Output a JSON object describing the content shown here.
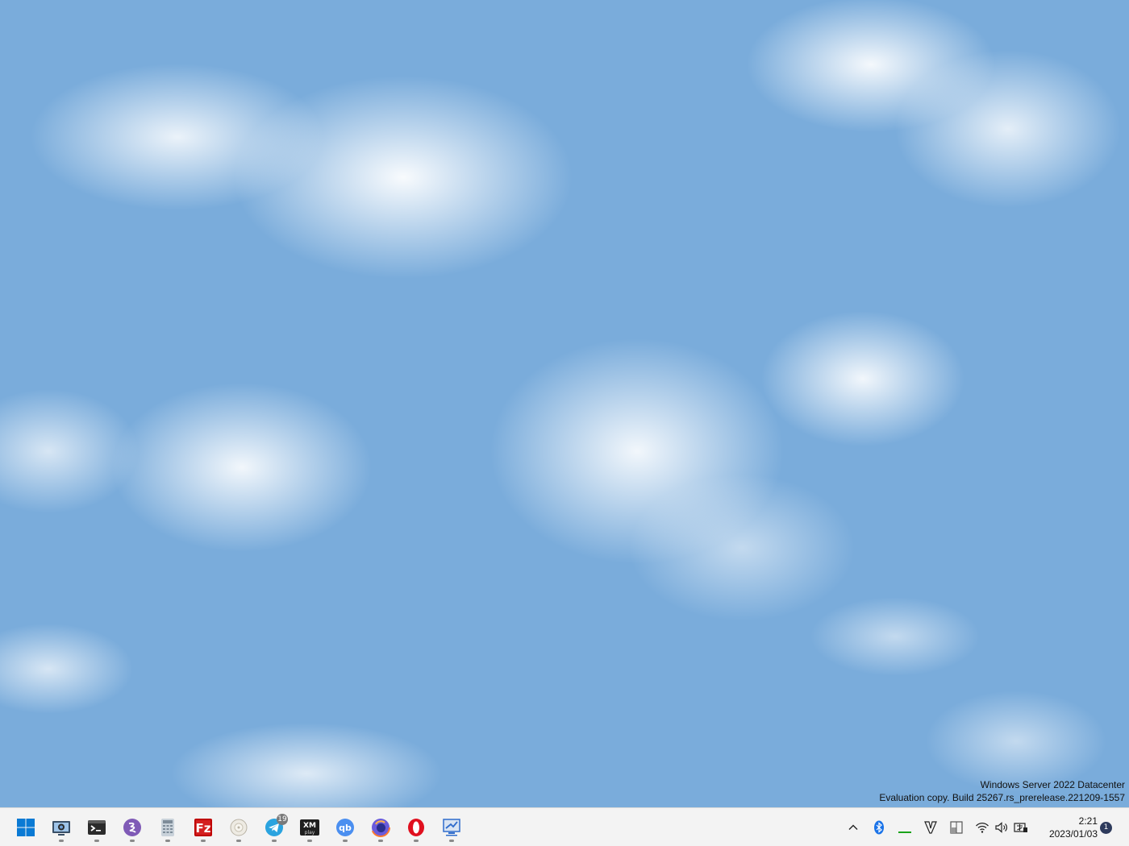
{
  "desktop": {
    "wallpaper": "sky-clouds",
    "watermark": {
      "line1": "Windows Server 2022 Datacenter",
      "line2": "Evaluation copy. Build 25267.rs_prerelease.221209-1557"
    }
  },
  "taskbar": {
    "background": "#f3f3f3",
    "apps": [
      {
        "name": "start",
        "icon": "windows-logo-icon",
        "color": "#0a7ad4"
      },
      {
        "name": "screenshot-tool",
        "icon": "camera-monitor-icon",
        "color": "#3a4f66",
        "running": true
      },
      {
        "name": "terminal",
        "icon": "terminal-icon",
        "color": "#2b2b2b",
        "running": true
      },
      {
        "name": "emacs",
        "icon": "emacs-icon",
        "color": "#7f5ab6",
        "running": true
      },
      {
        "name": "calculator",
        "icon": "calculator-icon",
        "color": "#9aa6b2",
        "running": true
      },
      {
        "name": "filezilla",
        "icon": "filezilla-icon",
        "color": "#bf0000",
        "running": true
      },
      {
        "name": "app-round",
        "icon": "disc-icon",
        "color": "#d9d4c8",
        "running": true
      },
      {
        "name": "telegram",
        "icon": "telegram-icon",
        "color": "#2aa3df",
        "running": true,
        "badge": "19"
      },
      {
        "name": "xmplay",
        "icon": "xmplay-icon",
        "color": "#1f1f1f",
        "running": true
      },
      {
        "name": "qbittorrent",
        "icon": "qbittorrent-icon",
        "color": "#4b8ff0",
        "running": true
      },
      {
        "name": "firefox",
        "icon": "firefox-icon",
        "color": "#6a5bdb",
        "running": true
      },
      {
        "name": "opera",
        "icon": "opera-icon",
        "color": "#e0101f",
        "running": true
      },
      {
        "name": "remote-desktop",
        "icon": "remote-desktop-icon",
        "color": "#2f6ccc",
        "running": true
      }
    ],
    "tray": {
      "items": [
        {
          "name": "show-hidden",
          "icon": "chevron-up-icon"
        },
        {
          "name": "bluetooth",
          "icon": "bluetooth-icon",
          "color": "#1a73e8"
        },
        {
          "name": "gpu-meter",
          "icon": "green-bar-icon",
          "color": "#1aa31a"
        },
        {
          "name": "vim-tray",
          "icon": "vim-icon"
        },
        {
          "name": "layout-tray",
          "icon": "window-layout-icon"
        },
        {
          "name": "wifi",
          "icon": "wifi-icon"
        },
        {
          "name": "volume",
          "icon": "speaker-icon"
        },
        {
          "name": "ime",
          "icon": "ime-icon"
        }
      ],
      "time": "2:21",
      "date": "2023/01/03",
      "notification_count": "1"
    }
  }
}
